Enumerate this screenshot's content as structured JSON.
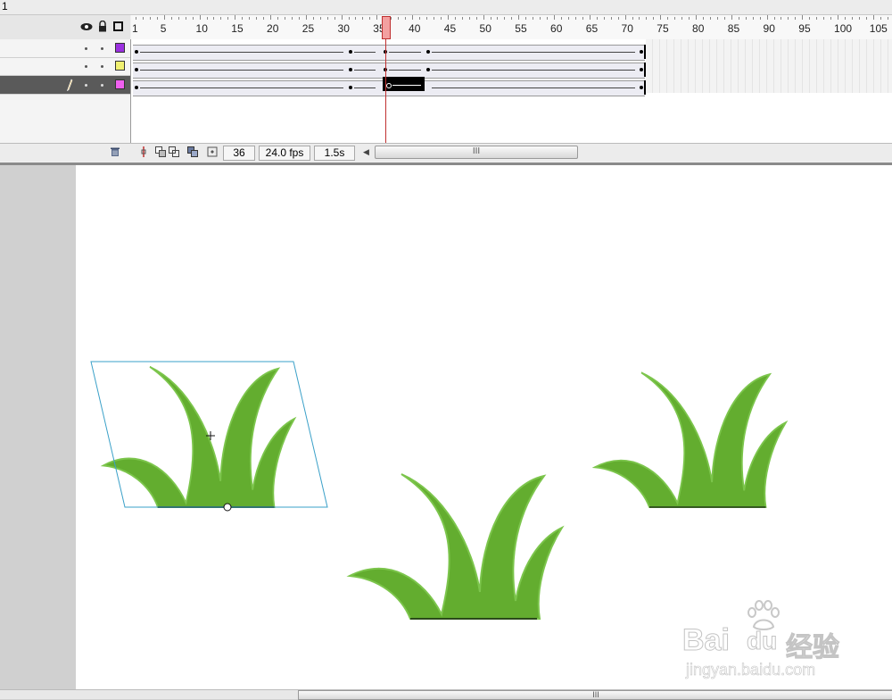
{
  "window": {
    "title_fragment": "1"
  },
  "timeline": {
    "ruler_labels": [
      "1",
      "5",
      "10",
      "15",
      "20",
      "25",
      "30",
      "35",
      "40",
      "45",
      "50",
      "55",
      "60",
      "65",
      "70",
      "75",
      "80",
      "85",
      "90",
      "95",
      "100",
      "105"
    ],
    "current_frame": "36",
    "frame_rate": "24.0 fps",
    "elapsed_time": "1.5s",
    "scroll_grip": "III",
    "layers": [
      {
        "swatch_color": "#9b30e0"
      },
      {
        "swatch_color": "#f0f070"
      },
      {
        "swatch_color": "#f060f0",
        "active": true
      }
    ],
    "header_icons": [
      "eye-icon",
      "lock-icon",
      "outline-icon"
    ]
  },
  "stage": {
    "grass_color": "#63ad2f",
    "grass_edge_color": "#7cc54c",
    "selection_color": "#3aa0c8"
  },
  "watermark": {
    "brand": "Bai",
    "brand_du": "du",
    "brand_cn": "经验",
    "url": "jingyan.baidu.com"
  },
  "bottom_scroll": {
    "grip": "III"
  }
}
